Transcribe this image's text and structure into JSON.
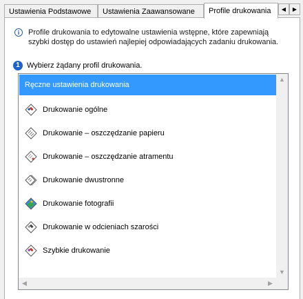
{
  "tabs": [
    {
      "label": "Ustawienia Podstawowe"
    },
    {
      "label": "Ustawienia Zaawansowane"
    },
    {
      "label": "Profile drukowania"
    }
  ],
  "tab_scroll": {
    "left": "◀",
    "right": "▶"
  },
  "info": {
    "icon": "i",
    "text": "Profile drukowania to edytowalne ustawienia wstępne, które zapewniają szybki dostęp do ustawień najlepiej odpowiadających zadaniu drukowania."
  },
  "step": {
    "number": "1",
    "label": "Wybierz żądany profil drukowania."
  },
  "profiles": [
    {
      "label": "Ręczne ustawienia drukowania",
      "icon": "none",
      "selected": true
    },
    {
      "label": "Drukowanie ogólne",
      "icon": "general-print-icon"
    },
    {
      "label": "Drukowanie – oszczędzanie papieru",
      "icon": "paper-saving-icon"
    },
    {
      "label": "Drukowanie – oszczędzanie atramentu",
      "icon": "ink-saving-icon"
    },
    {
      "label": "Drukowanie dwustronne",
      "icon": "duplex-print-icon"
    },
    {
      "label": "Drukowanie fotografii",
      "icon": "photo-print-icon"
    },
    {
      "label": "Drukowanie w odcieniach szarości",
      "icon": "grayscale-print-icon"
    },
    {
      "label": "Szybkie drukowanie",
      "icon": "fast-print-icon"
    }
  ],
  "scroll_arrows": {
    "up": "▲",
    "down": "▼",
    "left": "◀",
    "right": "▶"
  },
  "colors": {
    "selection": "#3399ff",
    "accent": "#1e63c8"
  }
}
